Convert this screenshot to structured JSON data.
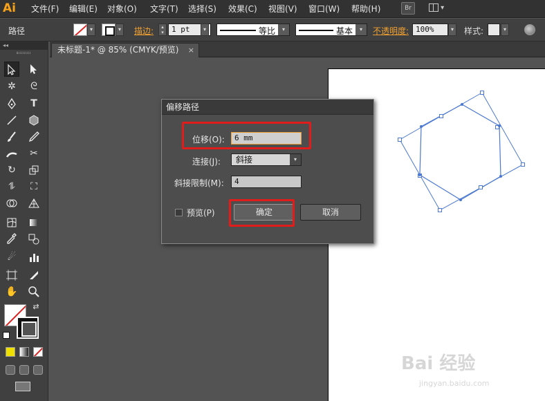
{
  "app": {
    "logo": "Ai"
  },
  "menu": [
    "文件(F)",
    "编辑(E)",
    "对象(O)",
    "文字(T)",
    "选择(S)",
    "效果(C)",
    "视图(V)",
    "窗口(W)",
    "帮助(H)"
  ],
  "menubar_right": {
    "bridge": "Br"
  },
  "control": {
    "selection_label": "路径",
    "stroke_label": "描边:",
    "stroke_weight": "1 pt",
    "profile_label": "等比",
    "brush_label": "基本",
    "opacity_label": "不透明度:",
    "opacity_value": "100%",
    "style_label": "样式:"
  },
  "document_tab": {
    "title": "未标题-1* @ 85% (CMYK/预览)",
    "close": "×"
  },
  "tools_header": "◂◂",
  "dialog": {
    "title": "偏移路径",
    "offset_label": "位移(O):",
    "offset_value": "6 mm",
    "join_label": "连接(J):",
    "join_value": "斜接",
    "miter_label": "斜接限制(M):",
    "miter_value": "4",
    "preview_label": "预览(P)",
    "ok": "确定",
    "cancel": "取消"
  },
  "watermark": {
    "main": "Bai 经验",
    "sub": "jingyan.baidu.com"
  },
  "colors": {
    "accent_orange": "#f0a030",
    "highlight_red": "#e21b1b",
    "path_blue": "#4a78d0"
  }
}
